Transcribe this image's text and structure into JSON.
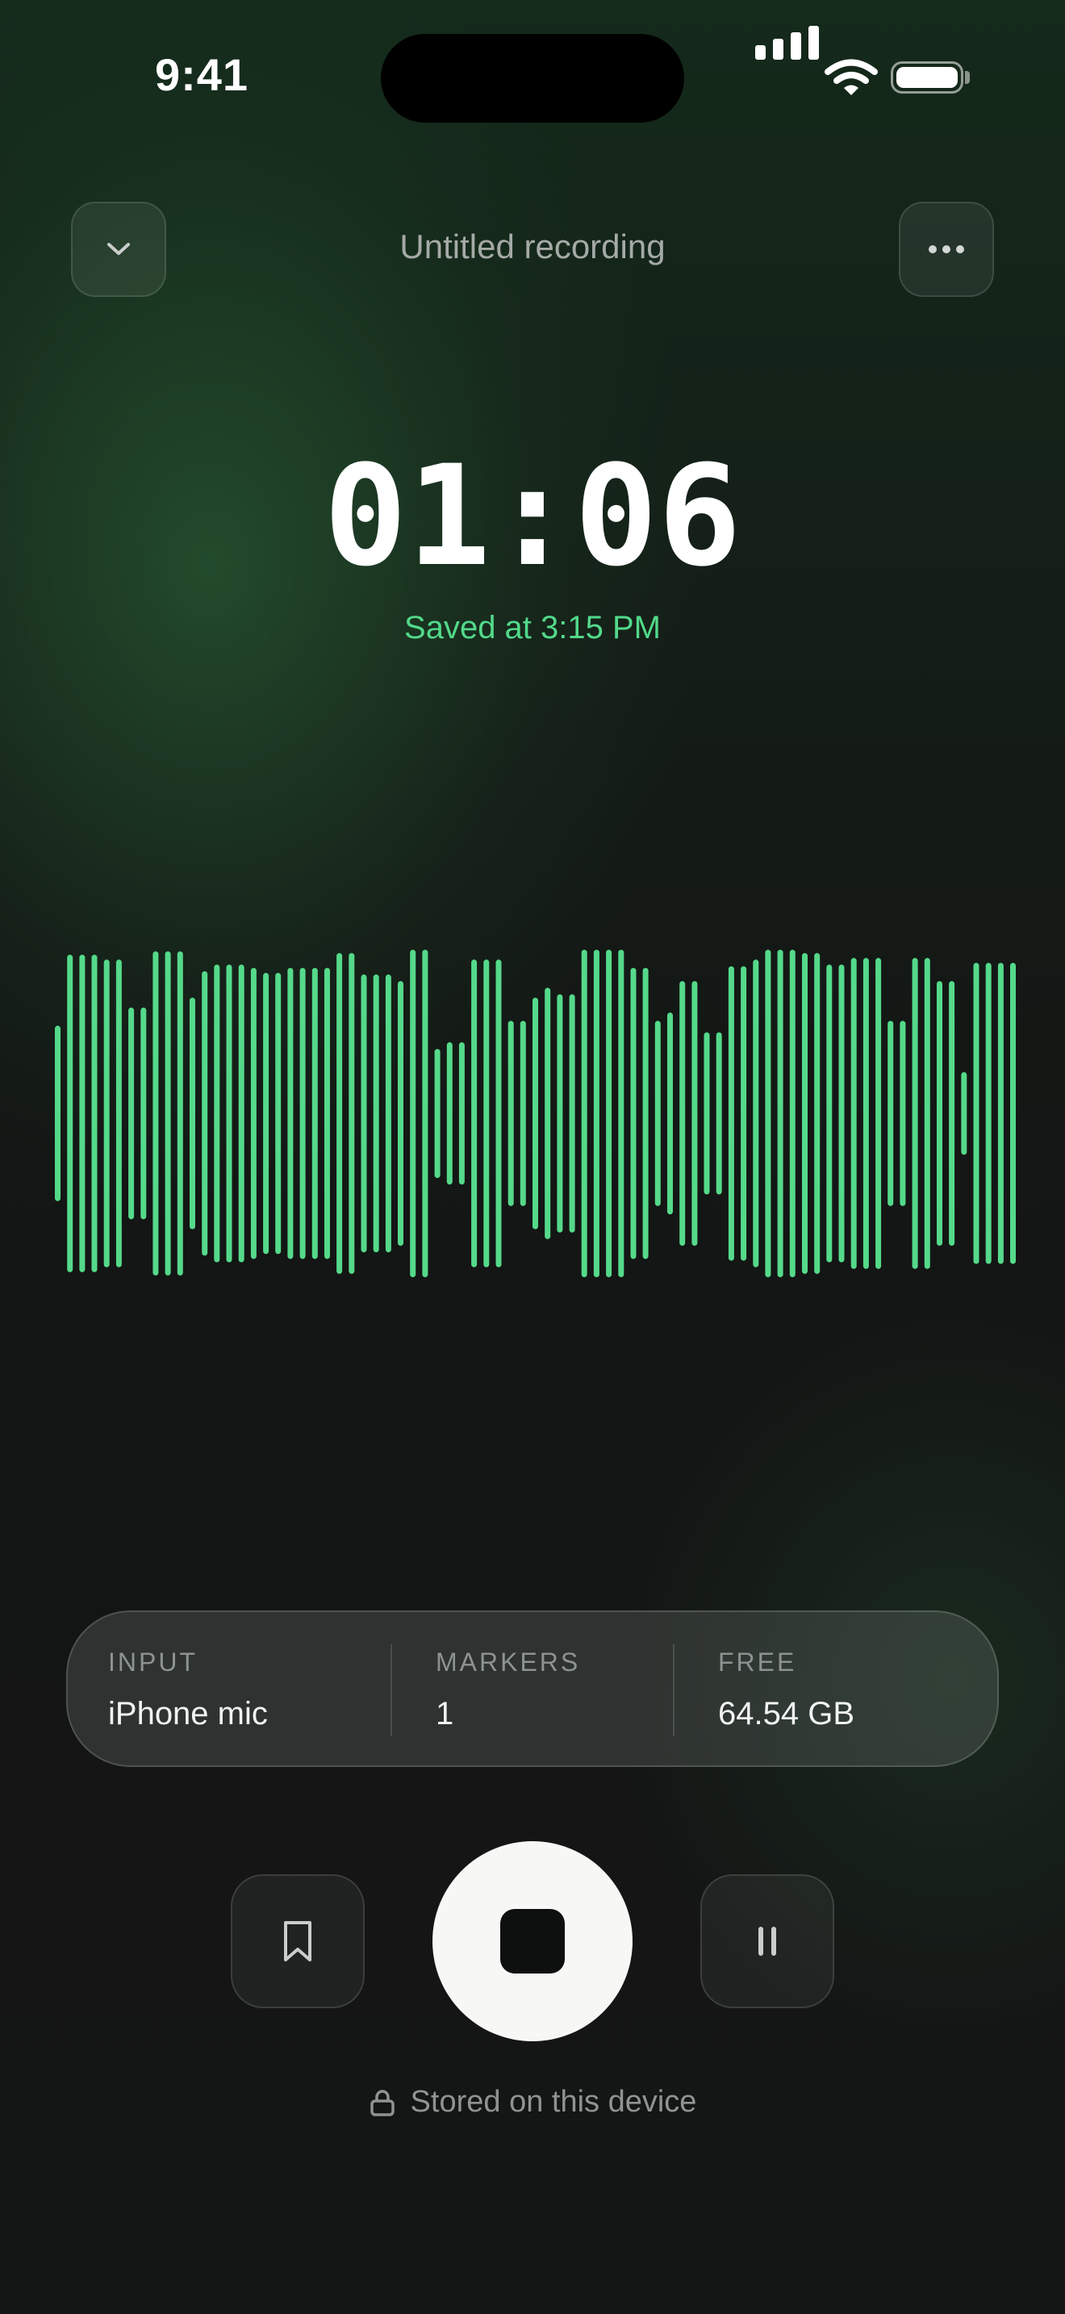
{
  "status_bar": {
    "time": "9:41"
  },
  "header": {
    "title": "Untitled recording"
  },
  "timer": {
    "elapsed": "01:06",
    "saved_text": "Saved at 3:15 PM"
  },
  "waveform": {
    "color": "#55D98A",
    "levels": [
      0.53,
      0.96,
      0.96,
      0.96,
      0.93,
      0.93,
      0.64,
      0.64,
      0.98,
      0.98,
      0.98,
      0.7,
      0.86,
      0.9,
      0.9,
      0.9,
      0.88,
      0.85,
      0.85,
      0.88,
      0.88,
      0.88,
      0.88,
      0.97,
      0.97,
      0.84,
      0.84,
      0.84,
      0.8,
      0.99,
      0.99,
      0.39,
      0.43,
      0.43,
      0.93,
      0.93,
      0.93,
      0.56,
      0.56,
      0.7,
      0.76,
      0.72,
      0.72,
      0.99,
      0.99,
      0.99,
      0.99,
      0.88,
      0.88,
      0.56,
      0.61,
      0.8,
      0.8,
      0.49,
      0.49,
      0.89,
      0.89,
      0.93,
      0.99,
      0.99,
      0.99,
      0.97,
      0.97,
      0.9,
      0.9,
      0.94,
      0.94,
      0.94,
      0.56,
      0.56,
      0.94,
      0.94,
      0.8,
      0.8,
      0.25,
      0.91,
      0.91,
      0.91,
      0.91
    ]
  },
  "info": {
    "input": {
      "label": "INPUT",
      "value": "iPhone mic"
    },
    "markers": {
      "label": "MARKERS",
      "value": "1"
    },
    "free": {
      "label": "FREE",
      "value": "64.54 GB"
    }
  },
  "footer": {
    "storage_text": "Stored on this device"
  },
  "colors": {
    "accent": "#52D98A",
    "background": "#141515",
    "stop_button": "#F7F7F5"
  }
}
